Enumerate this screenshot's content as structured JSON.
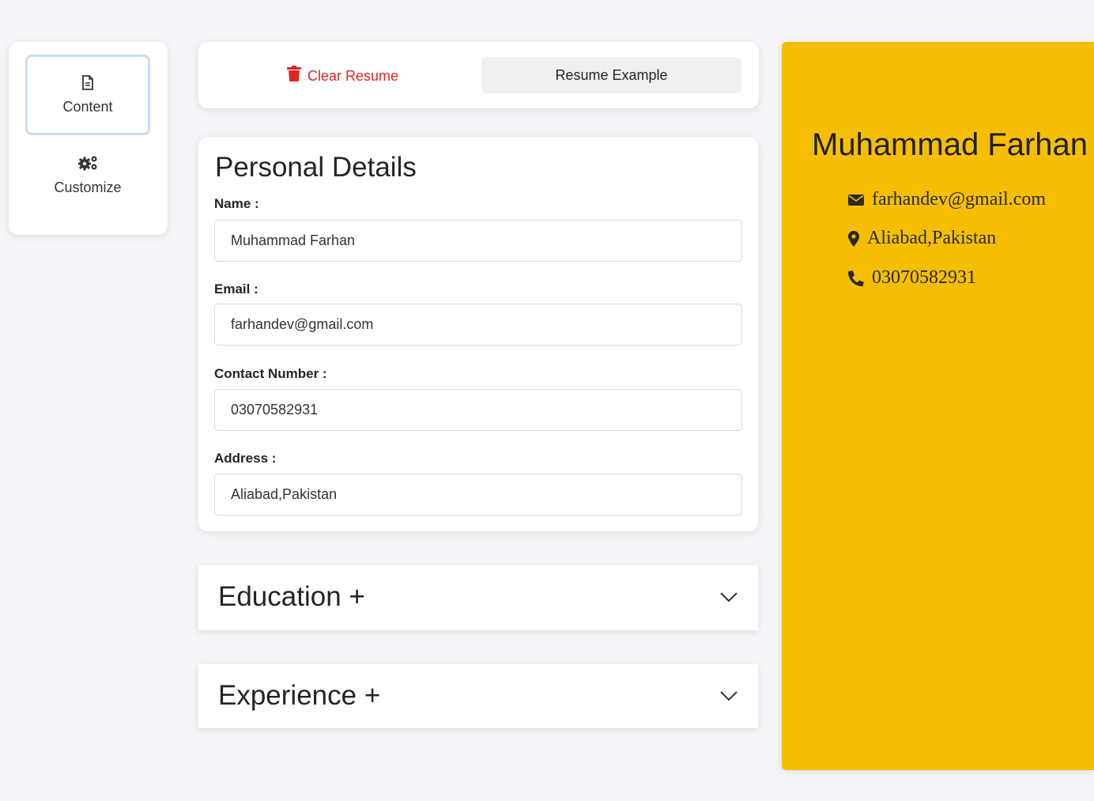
{
  "nav": {
    "items": [
      {
        "label": "Content",
        "icon": "document-icon",
        "active": true
      },
      {
        "label": "Customize",
        "icon": "gears-icon",
        "active": false
      }
    ]
  },
  "toolbar": {
    "clear_label": "Clear Resume",
    "clear_color": "#e02424",
    "example_label": "Resume Example"
  },
  "personal": {
    "title": "Personal Details",
    "name_label": "Name :",
    "name_value": "Muhammad Farhan",
    "email_label": "Email :",
    "email_value": "farhandev@gmail.com",
    "contact_label": "Contact Number :",
    "contact_value": "03070582931",
    "address_label": "Address :",
    "address_value": "Aliabad,Pakistan"
  },
  "sections": [
    {
      "title": "Education +",
      "icon": "chevron-down-icon"
    },
    {
      "title": "Experience +",
      "icon": "chevron-down-icon"
    }
  ],
  "preview": {
    "background": "#f5be00",
    "name": "Muhammad Farhan",
    "email": "farhandev@gmail.com",
    "address": "Aliabad,Pakistan",
    "phone": "03070582931"
  }
}
